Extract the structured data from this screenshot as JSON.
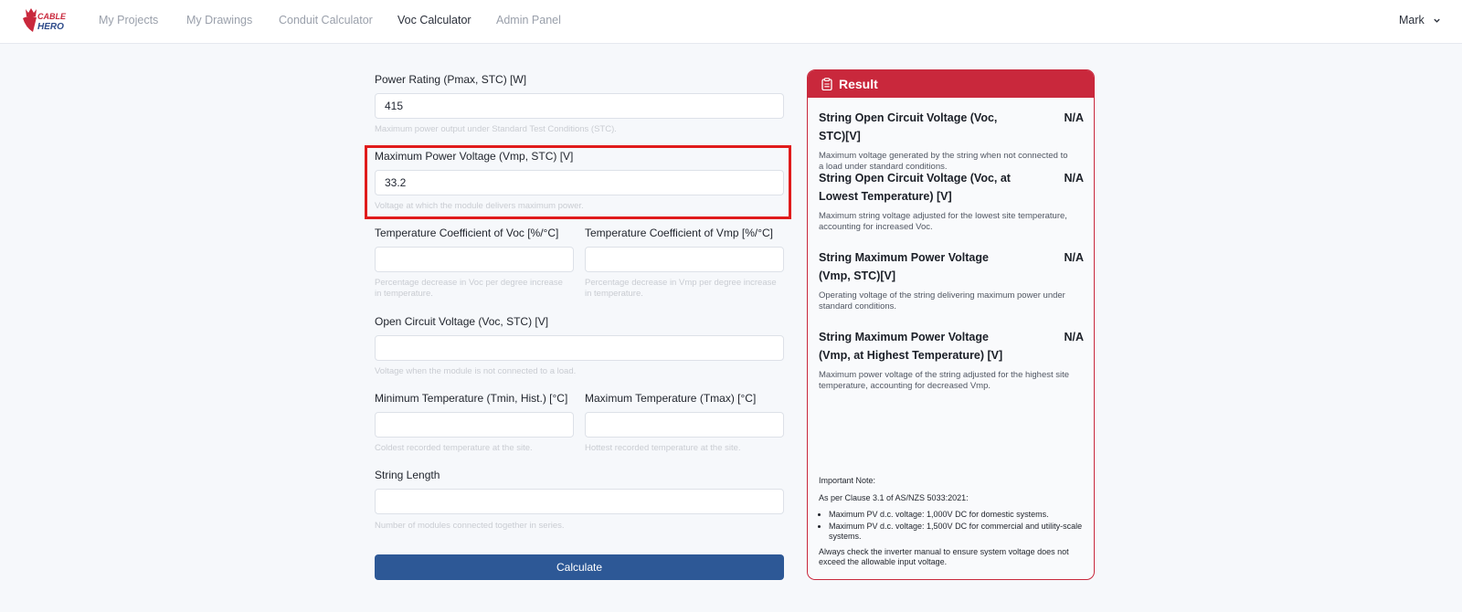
{
  "nav": {
    "logo_text": "CABLE HERO",
    "links": [
      "My Projects",
      "My Drawings",
      "Conduit Calculator",
      "Voc Calculator",
      "Admin Panel"
    ],
    "active": "Voc Calculator",
    "user": "Mark"
  },
  "form": {
    "pmax": {
      "label": "Power Rating (Pmax, STC) [W]",
      "value": "415",
      "hint": "Maximum power output under Standard Test Conditions (STC)."
    },
    "vmp": {
      "label": "Maximum Power Voltage (Vmp, STC) [V]",
      "value": "33.2",
      "hint": "Voltage at which the module delivers maximum power."
    },
    "temp_coef_voc": {
      "label": "Temperature Coefficient of Voc [%/°C]",
      "value": "",
      "hint": "Percentage decrease in Voc per degree increase in temperature."
    },
    "temp_coef_vmp": {
      "label": "Temperature Coefficient of Vmp [%/°C]",
      "value": "",
      "hint": "Percentage decrease in Vmp per degree increase in temperature."
    },
    "voc": {
      "label": "Open Circuit Voltage (Voc, STC) [V]",
      "value": "",
      "hint": "Voltage when the module is not connected to a load."
    },
    "tmin": {
      "label": "Minimum Temperature (Tmin, Hist.) [°C]",
      "value": "",
      "hint": "Coldest recorded temperature at the site."
    },
    "tmax": {
      "label": "Maximum Temperature (Tmax) [°C]",
      "value": "",
      "hint": "Hottest recorded temperature at the site."
    },
    "string_length": {
      "label": "String Length",
      "value": "",
      "hint": "Number of modules connected together in series."
    },
    "calculate_label": "Calculate"
  },
  "result": {
    "title": "Result",
    "items": [
      {
        "title": "String Open Circuit Voltage (Voc, STC)[V]",
        "value": "N/A",
        "desc": "Maximum voltage generated by the string when not connected to a load under standard conditions."
      },
      {
        "title": "String Open Circuit Voltage (Voc, at Lowest Temperature) [V]",
        "value": "N/A",
        "desc": "Maximum string voltage adjusted for the lowest site temperature, accounting for increased Voc."
      },
      {
        "title": "String Maximum Power Voltage (Vmp, STC)[V]",
        "value": "N/A",
        "desc": "Operating voltage of the string delivering maximum power under standard conditions."
      },
      {
        "title": "String Maximum Power Voltage (Vmp, at Highest Temperature) [V]",
        "value": "N/A",
        "desc": "Maximum power voltage of the string adjusted for the highest site temperature, accounting for decreased Vmp."
      }
    ],
    "note": {
      "heading": "Important Note:",
      "clause": "As per Clause 3.1 of AS/NZS 5033:2021:",
      "bullets": [
        "Maximum PV d.c. voltage: 1,000V DC for domestic systems.",
        "Maximum PV d.c. voltage: 1,500V DC for commercial and utility-scale systems."
      ],
      "footer": "Always check the inverter manual to ensure system voltage does not exceed the allowable input voltage."
    }
  },
  "colors": {
    "primary_button": "#2d5896",
    "result_accent": "#c9283c",
    "highlight": "#e01b1b"
  },
  "icons": [
    "logo-icon",
    "chevron-down-icon",
    "clipboard-icon"
  ]
}
